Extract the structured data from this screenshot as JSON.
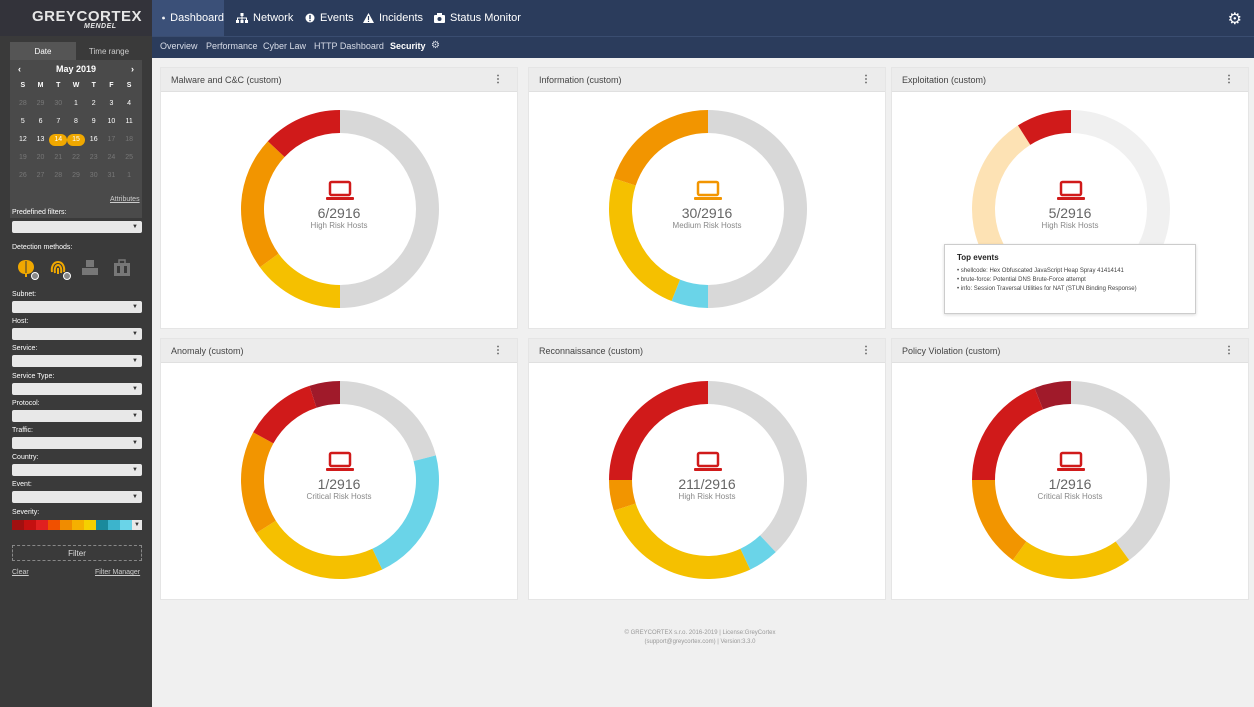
{
  "app": {
    "logo_main": "GREYCORTEX",
    "logo_sub": "MENDEL",
    "brand_color": "#2b3c5c",
    "accent": "#f0a800"
  },
  "nav": {
    "items": [
      {
        "label": "Dashboard",
        "icon": "dashboard-icon"
      },
      {
        "label": "Network",
        "icon": "network-icon"
      },
      {
        "label": "Events",
        "icon": "events-icon"
      },
      {
        "label": "Incidents",
        "icon": "warning-icon"
      },
      {
        "label": "Status Monitor",
        "icon": "monitor-icon"
      }
    ],
    "active": "Dashboard"
  },
  "subnav": {
    "items": [
      "Overview",
      "Performance",
      "Cyber Law",
      "HTTP Dashboard",
      "Security"
    ],
    "active": "Security"
  },
  "sidebar": {
    "tabs": [
      "Date",
      "Time range"
    ],
    "active_tab": "Date",
    "calendar": {
      "month": "May 2019",
      "prev": "‹",
      "next": "›",
      "weekdays": [
        "S",
        "M",
        "T",
        "W",
        "T",
        "F",
        "S"
      ],
      "days": [
        [
          "28",
          "dim"
        ],
        [
          "29",
          "dim"
        ],
        [
          "30",
          "dim"
        ],
        [
          "1",
          ""
        ],
        [
          "2",
          ""
        ],
        [
          "3",
          ""
        ],
        [
          "4",
          ""
        ],
        [
          "5",
          ""
        ],
        [
          "6",
          ""
        ],
        [
          "7",
          ""
        ],
        [
          "8",
          ""
        ],
        [
          "9",
          ""
        ],
        [
          "10",
          ""
        ],
        [
          "11",
          ""
        ],
        [
          "12",
          ""
        ],
        [
          "13",
          ""
        ],
        [
          "14",
          "sel"
        ],
        [
          "15",
          "sel"
        ],
        [
          "16",
          ""
        ],
        [
          "17",
          "dim"
        ],
        [
          "18",
          "dim"
        ],
        [
          "19",
          "dim"
        ],
        [
          "20",
          "dim"
        ],
        [
          "21",
          "dim"
        ],
        [
          "22",
          "dim"
        ],
        [
          "23",
          "dim"
        ],
        [
          "24",
          "dim"
        ],
        [
          "25",
          "dim"
        ],
        [
          "26",
          "dim"
        ],
        [
          "27",
          "dim"
        ],
        [
          "28",
          "dim"
        ],
        [
          "29",
          "dim"
        ],
        [
          "30",
          "dim"
        ],
        [
          "31",
          "dim"
        ],
        [
          "1",
          "dim"
        ]
      ]
    },
    "attributes_link": "Attributes",
    "predefined_filters": "Predefined filters:",
    "detection_methods": "Detection methods:",
    "filters": [
      "Subnet:",
      "Host:",
      "Service:",
      "Service Type:",
      "Protocol:",
      "Traffic:",
      "Country:",
      "Event:"
    ],
    "severity_label": "Severity:",
    "severity_colors": [
      "#a01010",
      "#c41010",
      "#e02020",
      "#f05000",
      "#f08c00",
      "#f5b000",
      "#f5d000",
      "#1a8a9c",
      "#3cb4cc",
      "#6ad4e8"
    ],
    "filter_button": "Filter",
    "clear_link": "Clear",
    "filter_manager_link": "Filter Manager"
  },
  "cards": [
    {
      "title": "Malware and C&C (custom)",
      "count": "6/2916",
      "risk": "High Risk Hosts",
      "icon_color": "#d01a1a",
      "segments": [
        {
          "value": 50,
          "color": "#d8d8d8"
        },
        {
          "value": 15,
          "color": "#f5c000"
        },
        {
          "value": 22,
          "color": "#f29500"
        },
        {
          "value": 13,
          "color": "#d01a1a"
        }
      ]
    },
    {
      "title": "Information (custom)",
      "count": "30/2916",
      "risk": "Medium Risk Hosts",
      "icon_color": "#f29500",
      "segments": [
        {
          "value": 50,
          "color": "#d8d8d8"
        },
        {
          "value": 6,
          "color": "#6ad4e8"
        },
        {
          "value": 24,
          "color": "#f5c000"
        },
        {
          "value": 20,
          "color": "#f29500"
        }
      ]
    },
    {
      "title": "Exploitation (custom)",
      "count": "5/2916",
      "risk": "High Risk Hosts",
      "icon_color": "#d01a1a",
      "segments": [
        {
          "value": 50,
          "color": "#f0f0f0"
        },
        {
          "value": 16,
          "color": "#fde7b8"
        },
        {
          "value": 25,
          "color": "#fde2b4"
        },
        {
          "value": 9,
          "color": "#d01a1a"
        }
      ]
    },
    {
      "title": "Anomaly (custom)",
      "count": "1/2916",
      "risk": "Critical Risk Hosts",
      "icon_color": "#d01a1a",
      "segments": [
        {
          "value": 21,
          "color": "#d8d8d8"
        },
        {
          "value": 22,
          "color": "#6ad4e8"
        },
        {
          "value": 23,
          "color": "#f5c000"
        },
        {
          "value": 17,
          "color": "#f29500"
        },
        {
          "value": 12,
          "color": "#d01a1a"
        },
        {
          "value": 5,
          "color": "#a01a2a"
        }
      ]
    },
    {
      "title": "Reconnaissance (custom)",
      "count": "211/2916",
      "risk": "High Risk Hosts",
      "icon_color": "#d01a1a",
      "segments": [
        {
          "value": 38,
          "color": "#d8d8d8"
        },
        {
          "value": 5,
          "color": "#6ad4e8"
        },
        {
          "value": 27,
          "color": "#f5c000"
        },
        {
          "value": 5,
          "color": "#f29500"
        },
        {
          "value": 25,
          "color": "#d01a1a"
        }
      ]
    },
    {
      "title": "Policy Violation (custom)",
      "count": "1/2916",
      "risk": "Critical Risk Hosts",
      "icon_color": "#d01a1a",
      "segments": [
        {
          "value": 40,
          "color": "#d8d8d8"
        },
        {
          "value": 20,
          "color": "#f5c000"
        },
        {
          "value": 15,
          "color": "#f29500"
        },
        {
          "value": 19,
          "color": "#d01a1a"
        },
        {
          "value": 6,
          "color": "#a01a2a"
        }
      ]
    }
  ],
  "tooltip": {
    "title": "Top events",
    "items": [
      "shellcode: Hex Obfuscated JavaScript Heap Spray 41414141",
      "brute-force: Potential DNS Brute-Force attempt",
      "info: Session Traversal Utilities for NAT (STUN Binding Response)"
    ]
  },
  "footer": {
    "line1": "© GREYCORTEX s.r.o. 2016-2019 | License:GreyCortex",
    "line2": "(support@greycortex.com) | Version:3.3.0"
  }
}
